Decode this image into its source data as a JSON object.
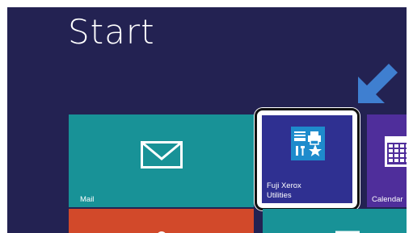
{
  "screen": {
    "title": "Start"
  },
  "tiles": {
    "mail": {
      "label": "Mail",
      "icon": "envelope-icon",
      "color": "#189297"
    },
    "fuji": {
      "label_line1": "Fuji Xerox",
      "label_line2": "Utilities",
      "icon": "fuji-xerox-utilities-icon",
      "color": "#2f3091"
    },
    "calendar": {
      "label": "Calendar",
      "icon": "calendar-icon",
      "color": "#4f2e9b"
    }
  },
  "pointer": {
    "icon": "pointer-arrow-icon",
    "color": "#3f7fd0"
  }
}
